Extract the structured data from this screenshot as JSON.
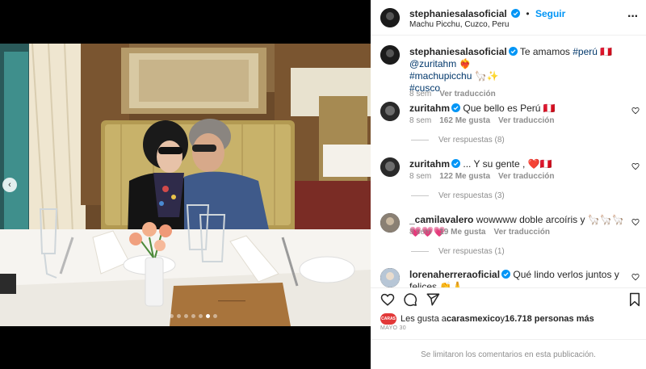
{
  "post": {
    "author": "stephaniesalasoficial",
    "follow_label": "Seguir",
    "location": "Machu Picchu, Cuzco, Peru",
    "separator": "•"
  },
  "caption": {
    "user": "stephaniesalasoficial",
    "text_a": "Te amamos ",
    "tag_peru": "#perú",
    "flag": "🇵🇪",
    "mention": "@zuritahm",
    "emoji_a": "❤️‍🔥",
    "tag_mp": "#machupicchu",
    "emoji_b": "🦙✨",
    "tag_cusco": "#cusco",
    "time": "8 sem",
    "translate": "Ver traducción"
  },
  "comments": [
    {
      "user": "zuritahm",
      "text": "Que bello es Perú 🇵🇪",
      "time": "8 sem",
      "likes": "162 Me gusta",
      "translate": "Ver traducción",
      "replies": "Ver respuestas (8)"
    },
    {
      "user": "zuritahm",
      "text": "... Y su gente , ❤️🇵🇪",
      "time": "8 sem",
      "likes": "122 Me gusta",
      "translate": "Ver traducción",
      "replies": "Ver respuestas (3)"
    },
    {
      "user": "_camilavalero",
      "text": "wowwww doble arcoíris y 🦙🦙🦙💗💗💗",
      "time": "8 sem",
      "likes": "19 Me gusta",
      "translate": "Ver traducción",
      "replies": "Ver respuestas (1)"
    },
    {
      "user": "lorenaherreraoficial",
      "text": "Qué lindo verlos juntos y felices 👏🙏",
      "time": "",
      "likes": "",
      "translate": "",
      "replies": ""
    }
  ],
  "likes_line": {
    "prefix": "Les gusta a ",
    "user": "carasmexico",
    "mid": " y ",
    "count": "16.718 personas más",
    "badge": "CARAS"
  },
  "date": "MAYO 30",
  "comments_limited": "Se limitaron los comentarios en esta publicación.",
  "carousel": {
    "total": 7,
    "active": 6
  },
  "icons": [
    "verified-icon",
    "more-icon",
    "heart-icon",
    "comment-icon",
    "share-icon",
    "bookmark-icon",
    "chevron-left-icon"
  ],
  "colors": {
    "link": "#0095f6",
    "verified": "#0095f6",
    "hashtag": "#00376b",
    "muted": "#8e8e8e"
  }
}
